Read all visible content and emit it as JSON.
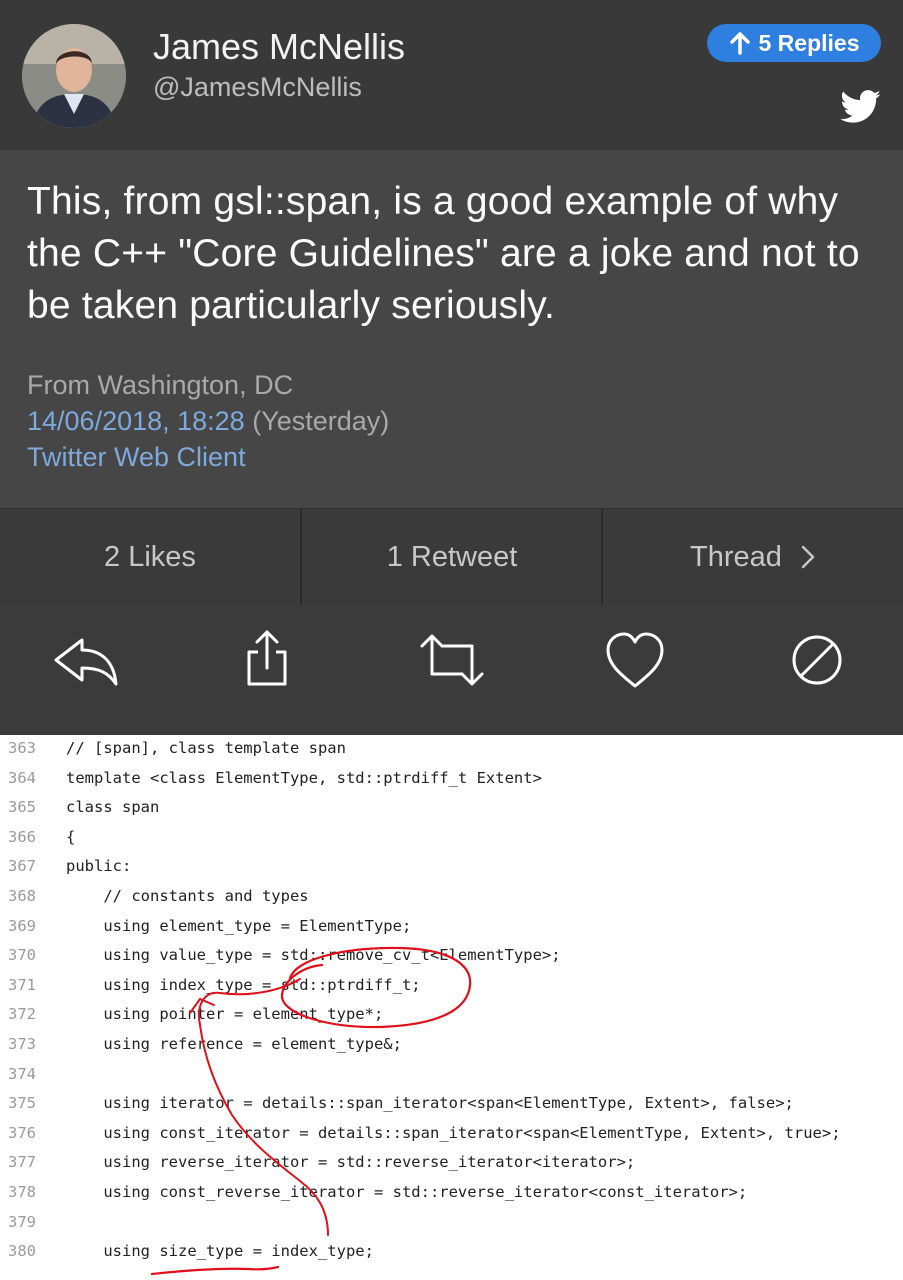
{
  "user": {
    "name": "James McNellis",
    "handle": "@JamesMcNellis"
  },
  "replies_label": "5 Replies",
  "tweet": {
    "text": "This, from gsl::span, is a good example of why the C++ \"Core Guidelines\" are a joke and not to be taken particularly seriously.",
    "location": "From Washington, DC",
    "date": "14/06/2018, 18:28",
    "date_note": "(Yesterday)",
    "client": "Twitter Web Client"
  },
  "stats": {
    "likes": "2 Likes",
    "retweets": "1 Retweet",
    "thread": "Thread"
  },
  "icons": [
    "reply-icon",
    "share-icon",
    "retweet-icon",
    "like-icon",
    "block-icon",
    "twitter-bird-icon",
    "arrow-up-icon",
    "chevron-right-icon"
  ],
  "colors": {
    "accent": "#2f7fe0",
    "link": "#7fa9dd",
    "annotation": "#e0101a"
  },
  "code": {
    "lines": [
      {
        "no": "363",
        "text": "// [span], class template span"
      },
      {
        "no": "364",
        "text": "template <class ElementType, std::ptrdiff_t Extent>"
      },
      {
        "no": "365",
        "text": "class span"
      },
      {
        "no": "366",
        "text": "{"
      },
      {
        "no": "367",
        "text": "public:"
      },
      {
        "no": "368",
        "text": "    // constants and types"
      },
      {
        "no": "369",
        "text": "    using element_type = ElementType;"
      },
      {
        "no": "370",
        "text": "    using value_type = std::remove_cv_t<ElementType>;"
      },
      {
        "no": "371",
        "text": "    using index_type = std::ptrdiff_t;"
      },
      {
        "no": "372",
        "text": "    using pointer = element_type*;"
      },
      {
        "no": "373",
        "text": "    using reference = element_type&;"
      },
      {
        "no": "374",
        "text": ""
      },
      {
        "no": "375",
        "text": "    using iterator = details::span_iterator<span<ElementType, Extent>, false>;"
      },
      {
        "no": "376",
        "text": "    using const_iterator = details::span_iterator<span<ElementType, Extent>, true>;"
      },
      {
        "no": "377",
        "text": "    using reverse_iterator = std::reverse_iterator<iterator>;"
      },
      {
        "no": "378",
        "text": "    using const_reverse_iterator = std::reverse_iterator<const_iterator>;"
      },
      {
        "no": "379",
        "text": ""
      },
      {
        "no": "380",
        "text": "    using size_type = index_type;"
      }
    ]
  }
}
